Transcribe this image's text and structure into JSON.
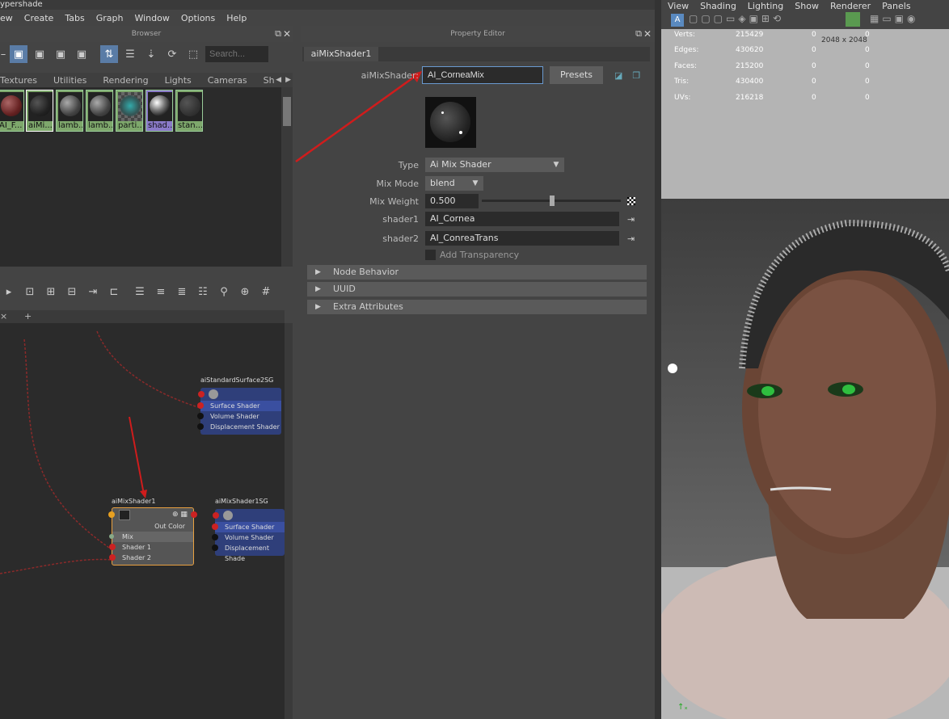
{
  "window": {
    "title": "ypershade"
  },
  "menu": [
    "ew",
    "Create",
    "Tabs",
    "Graph",
    "Window",
    "Options",
    "Help"
  ],
  "browser": {
    "header": "Browser",
    "search_placeholder": "Search...",
    "tabs": [
      "Textures",
      "Utilities",
      "Rendering",
      "Lights",
      "Cameras",
      "Sh"
    ],
    "swatches": [
      {
        "label": "AI_F...",
        "color": "#8a4a3a"
      },
      {
        "label": "aiMi...",
        "color": "#3a3a3a"
      },
      {
        "label": "lamb...",
        "color": "#6a6a6a"
      },
      {
        "label": "lamb...",
        "color": "#6a6a6a"
      },
      {
        "label": "parti...",
        "color": "#4a6a7a"
      },
      {
        "label": "shad...",
        "color": "#888"
      },
      {
        "label": "stan...",
        "color": "#3a3a3a"
      }
    ]
  },
  "graph": {
    "tab_close": "×",
    "tab_add": "+",
    "nodes": {
      "sg1": {
        "title": "aiStandardSurface2SG",
        "rows": [
          "Surface Shader",
          "Volume Shader",
          "Displacement Shader"
        ]
      },
      "mix": {
        "title": "aiMixShader1",
        "out": "Out Color",
        "rows": [
          "Mix",
          "Shader 1",
          "Shader 2"
        ]
      },
      "sg2": {
        "title": "aiMixShader1SG",
        "rows": [
          "Surface Shader",
          "Volume Shader",
          "Displacement Shade"
        ]
      }
    }
  },
  "property_editor": {
    "header": "Property Editor",
    "tab": "aiMixShader1",
    "name_label": "aiMixShader:",
    "name_value": "AI_CorneaMix",
    "presets": "Presets",
    "type_label": "Type",
    "type_value": "Ai Mix Shader",
    "mixmode_label": "Mix Mode",
    "mixmode_value": "blend",
    "mixweight_label": "Mix Weight",
    "mixweight_value": "0.500",
    "shader1_label": "shader1",
    "shader1_value": "AI_Cornea",
    "shader2_label": "shader2",
    "shader2_value": "AI_ConreaTrans",
    "add_transparency": "Add Transparency",
    "sections": [
      "Node Behavior",
      "UUID",
      "Extra Attributes"
    ]
  },
  "viewport": {
    "menu": [
      "View",
      "Shading",
      "Lighting",
      "Show",
      "Renderer",
      "Panels"
    ],
    "resolution": "2048 x 2048",
    "stats": [
      {
        "label": "Verts:",
        "a": "215429",
        "b": "0",
        "c": "0"
      },
      {
        "label": "Edges:",
        "a": "430620",
        "b": "0",
        "c": "0"
      },
      {
        "label": "Faces:",
        "a": "215200",
        "b": "0",
        "c": "0"
      },
      {
        "label": "Tris:",
        "a": "430400",
        "b": "0",
        "c": "0"
      },
      {
        "label": "UVs:",
        "a": "216218",
        "b": "0",
        "c": "0"
      }
    ]
  }
}
